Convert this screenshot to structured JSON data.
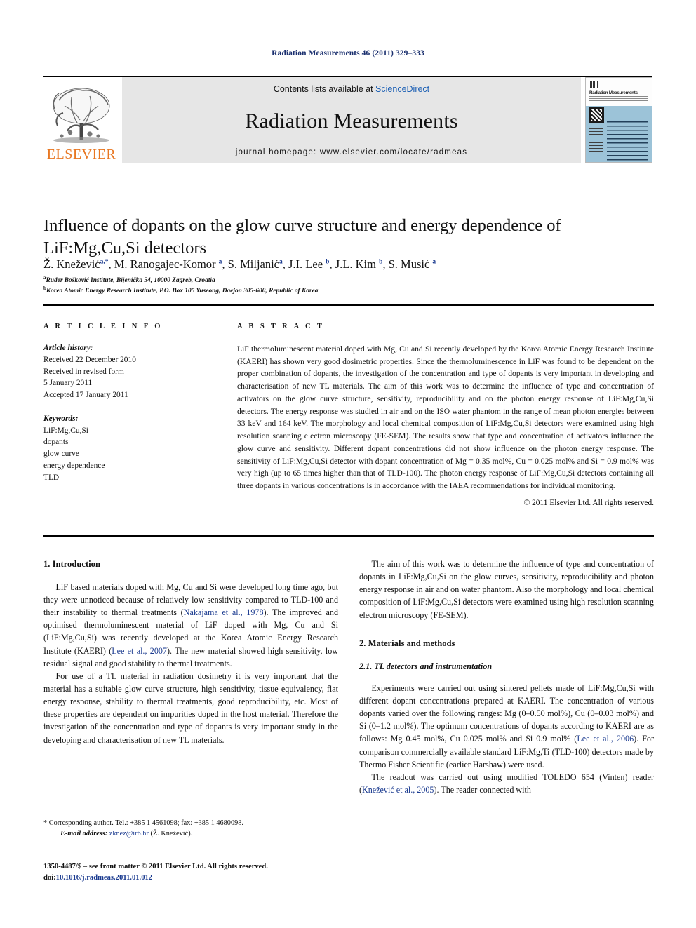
{
  "running_head": "Radiation Measurements 46 (2011) 329–333",
  "masthead": {
    "publisher_name": "ELSEVIER",
    "contents_prefix": "Contents lists available at ",
    "contents_link": "ScienceDirect",
    "journal_title": "Radiation Measurements",
    "homepage_line": "journal homepage: www.elsevier.com/locate/radmeas",
    "cover": {
      "title": "Radiation Measurements"
    }
  },
  "article": {
    "title": "Influence of dopants on the glow curve structure and energy dependence of LiF:Mg,Cu,Si detectors",
    "authors_html": "Ž. Knežević<sup>a,*</sup>, M. Ranogajec-Komor <sup>a</sup>, S. Miljanić<sup>a</sup>, J.I. Lee <sup>b</sup>, J.L. Kim <sup>b</sup>, S. Musić <sup>a</sup>",
    "affiliations": [
      {
        "marker": "a",
        "text": "Ruđer Bošković Institute, Bijenička 54, 10000 Zagreb, Croatia"
      },
      {
        "marker": "b",
        "text": "Korea Atomic Energy Research Institute, P.O. Box 105 Yuseong, Daejon 305-600, Republic of Korea"
      }
    ]
  },
  "article_info": {
    "heading": "A R T I C L E  I N F O",
    "history_label": "Article history:",
    "history_lines": [
      "Received 22 December 2010",
      "Received in revised form",
      "5 January 2011",
      "Accepted 17 January 2011"
    ],
    "keywords_label": "Keywords:",
    "keywords": [
      "LiF:Mg,Cu,Si",
      "dopants",
      "glow curve",
      "energy dependence",
      "TLD"
    ]
  },
  "abstract": {
    "heading": "A B S T R A C T",
    "text": "LiF thermoluminescent material doped with Mg, Cu and Si recently developed by the Korea Atomic Energy Research Institute (KAERI) has shown very good dosimetric properties. Since the thermoluminescence in LiF was found to be dependent on the proper combination of dopants, the investigation of the concentration and type of dopants is very important in developing and characterisation of new TL materials. The aim of this work was to determine the influence of type and concentration of activators on the glow curve structure, sensitivity, reproducibility and on the photon energy response of LiF:Mg,Cu,Si detectors. The energy response was studied in air and on the ISO water phantom in the range of mean photon energies between 33 keV and 164 keV. The morphology and local chemical composition of LiF:Mg,Cu,Si detectors were examined using high resolution scanning electron microscopy (FE-SEM). The results show that type and concentration of activators influence the glow curve and sensitivity. Different dopant concentrations did not show influence on the photon energy response. The sensitivity of LiF:Mg,Cu,Si detector with dopant concentration of Mg = 0.35 mol%, Cu = 0.025 mol% and Si = 0.9 mol% was very high (up to 65 times higher than that of TLD-100). The photon energy response of LiF:Mg,Cu,Si detectors containing all three dopants in various concentrations is in accordance with the IAEA recommendations for individual monitoring.",
    "copyright": "© 2011 Elsevier Ltd. All rights reserved."
  },
  "body": {
    "left_column": {
      "section_heading": "1.  Introduction",
      "paragraphs": [
        {
          "parts": [
            {
              "t": "LiF based materials doped with Mg, Cu and Si were developed long time ago, but they were unnoticed because of relatively low sensitivity compared to TLD-100 and their instability to thermal treatments ("
            },
            {
              "t": "Nakajama et al., 1978",
              "ref": true
            },
            {
              "t": "). The improved and optimised thermoluminescent material of LiF doped with Mg, Cu and Si (LiF:Mg,Cu,Si) was recently developed at the Korea Atomic Energy Research Institute (KAERI) ("
            },
            {
              "t": "Lee et al., 2007",
              "ref": true
            },
            {
              "t": "). The new material showed high sensitivity, low residual signal and good stability to thermal treatments."
            }
          ]
        },
        {
          "parts": [
            {
              "t": "For use of a TL material in radiation dosimetry it is very important that the material has a suitable glow curve structure, high sensitivity, tissue equivalency, flat energy response, stability to thermal treatments, good reproducibility, etc. Most of these properties are dependent on impurities doped in the host material. Therefore the investigation of the concentration and type of dopants is very important study in the developing and characterisation of new TL materials."
            }
          ]
        }
      ]
    },
    "right_column": {
      "intro_paragraph": {
        "parts": [
          {
            "t": "The aim of this work was to determine the influence of type and concentration of dopants in LiF:Mg,Cu,Si on the glow curves, sensitivity, reproducibility and photon energy response in air and on water phantom. Also the morphology and local chemical composition of LiF:Mg,Cu,Si detectors were examined using high resolution scanning electron microscopy (FE-SEM)."
          }
        ]
      },
      "section_heading": "2.  Materials and methods",
      "subsection_heading": "2.1.  TL detectors and instrumentation",
      "paragraphs": [
        {
          "parts": [
            {
              "t": "Experiments were carried out using sintered pellets made of LiF:Mg,Cu,Si with different dopant concentrations prepared at KAERI. The concentration of various dopants varied over the following ranges: Mg (0–0.50 mol%), Cu (0–0.03 mol%) and Si (0–1.2 mol%). The optimum concentrations of dopants according to KAERI are as follows: Mg 0.45 mol%, Cu 0.025 mol% and Si 0.9 mol% ("
            },
            {
              "t": "Lee et al., 2006",
              "ref": true
            },
            {
              "t": "). For comparison commercially available standard LiF:Mg,Ti (TLD-100) detectors made by Thermo Fisher Scientific (earlier Harshaw) were used."
            }
          ]
        },
        {
          "parts": [
            {
              "t": "The readout was carried out using modified TOLEDO 654 (Vinten) reader ("
            },
            {
              "t": "Knežević et al., 2005",
              "ref": true
            },
            {
              "t": "). The reader connected with"
            }
          ]
        }
      ]
    }
  },
  "footnotes": {
    "corresponding": "* Corresponding author. Tel.: +385 1 4561098; fax: +385 1 4680098.",
    "email_label": "E-mail address:",
    "email": "zknez@irb.hr",
    "email_suffix": " (Ž. Knežević).",
    "colophon_main": "1350-4487/$ – see front matter © 2011 Elsevier Ltd. All rights reserved.",
    "doi_label": "doi:",
    "doi_value": "10.1016/j.radmeas.2011.01.012"
  }
}
